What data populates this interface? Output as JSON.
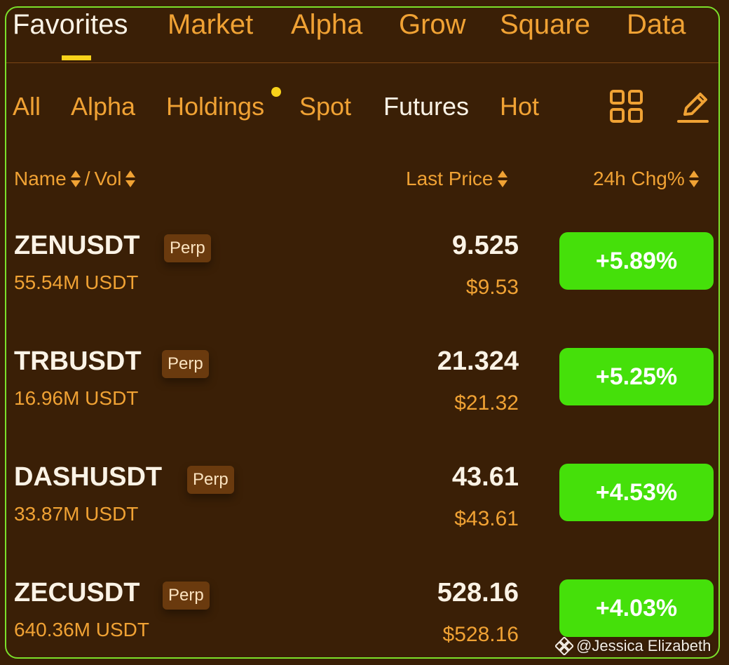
{
  "top_tabs": [
    "Favorites",
    "Market",
    "Alpha",
    "Grow",
    "Square",
    "Data"
  ],
  "sub_tabs": [
    "All",
    "Alpha",
    "Holdings",
    "Spot",
    "Futures",
    "Hot"
  ],
  "header": {
    "name": "Name",
    "sep": "/",
    "vol": "Vol",
    "last_price": "Last Price",
    "change": "24h Chg%"
  },
  "rows": [
    {
      "symbol": "ZENUSDT",
      "badge": "Perp",
      "volume": "55.54M USDT",
      "price": "9.525",
      "usd": "$9.53",
      "change": "+5.89%"
    },
    {
      "symbol": "TRBUSDT",
      "badge": "Perp",
      "volume": "16.96M USDT",
      "price": "21.324",
      "usd": "$21.32",
      "change": "+5.25%"
    },
    {
      "symbol": "DASHUSDT",
      "badge": "Perp",
      "volume": "33.87M USDT",
      "price": "43.61",
      "usd": "$43.61",
      "change": "+4.53%"
    },
    {
      "symbol": "ZECUSDT",
      "badge": "Perp",
      "volume": "640.36M USDT",
      "price": "528.16",
      "usd": "$528.16",
      "change": "+4.03%"
    }
  ],
  "watermark": "@Jessica Elizabeth",
  "colors": {
    "background": "#3a1f06",
    "accent": "#f0a234",
    "active_text": "#fbf3e6",
    "positive": "#45e00a",
    "indicator": "#f8d21a",
    "frame": "#7be02a"
  },
  "icons": [
    "grid-icon",
    "edit-icon",
    "sort-icon",
    "binance-logo-icon"
  ]
}
